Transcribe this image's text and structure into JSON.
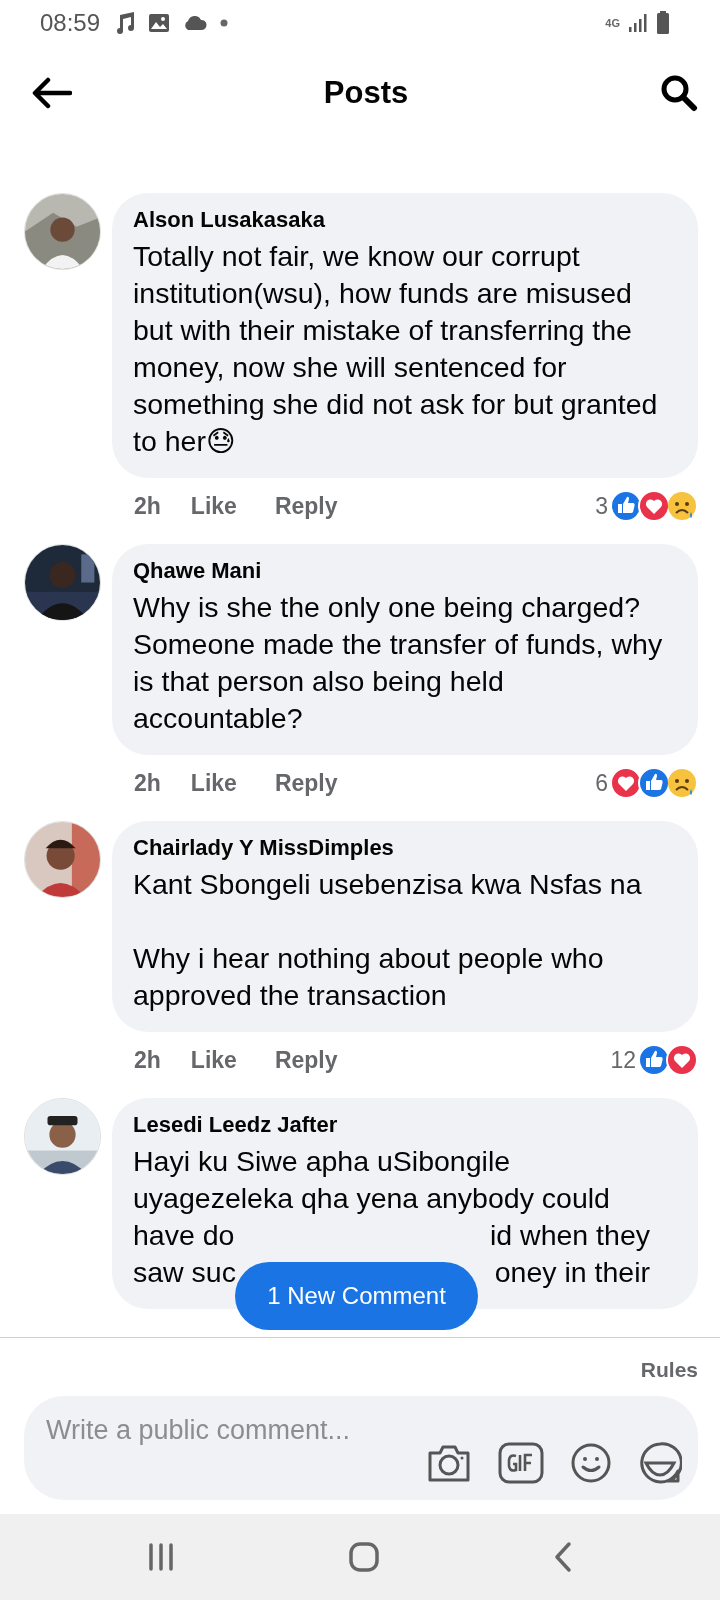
{
  "status_bar": {
    "time": "08:59",
    "network": "4G"
  },
  "header": {
    "title": "Posts"
  },
  "comments": [
    {
      "author": "Alson Lusakasaka",
      "kind": "text",
      "body": "Totally not fair, we know our corrupt institution(wsu), how funds are misused but with their mistake of transferring the money, now she will sentenced for something she did not ask for but granted to her😓",
      "time": "2h",
      "like": "Like",
      "reply": "Reply",
      "reaction_count": "3",
      "reactions": [
        {
          "kind": "like"
        },
        {
          "kind": "love"
        },
        {
          "kind": "sad"
        }
      ]
    },
    {
      "author": "Qhawe Mani",
      "kind": "text",
      "body": "Why is she the only one being charged? Someone made the transfer of funds, why is that person also being held accountable?",
      "time": "2h",
      "like": "Like",
      "reply": "Reply",
      "reaction_count": "6",
      "reactions": [
        {
          "kind": "love"
        },
        {
          "kind": "like"
        },
        {
          "kind": "sad"
        }
      ]
    },
    {
      "author": "Chairlady Y MissDimples",
      "kind": "text",
      "body": "Kant Sbongeli usebenzisa kwa Nsfas na\n\nWhy i hear nothing about people who approved the transaction",
      "time": "2h",
      "like": "Like",
      "reply": "Reply",
      "reaction_count": "12",
      "reactions": [
        {
          "kind": "like"
        },
        {
          "kind": "love"
        }
      ]
    },
    {
      "author": "Lesedi Leedz Jafter",
      "kind": "covered",
      "lines": [
        [
          "Hayi ku Siwe apha uSibongile"
        ],
        [
          "uyagezeleka qha yena anybody could"
        ],
        [
          "have do",
          "id when they"
        ],
        [
          "saw suc",
          "oney in their"
        ]
      ]
    }
  ],
  "new_comment_pill": "1 New Comment",
  "rules_link": "Rules",
  "composer": {
    "placeholder": "Write a public comment..."
  }
}
